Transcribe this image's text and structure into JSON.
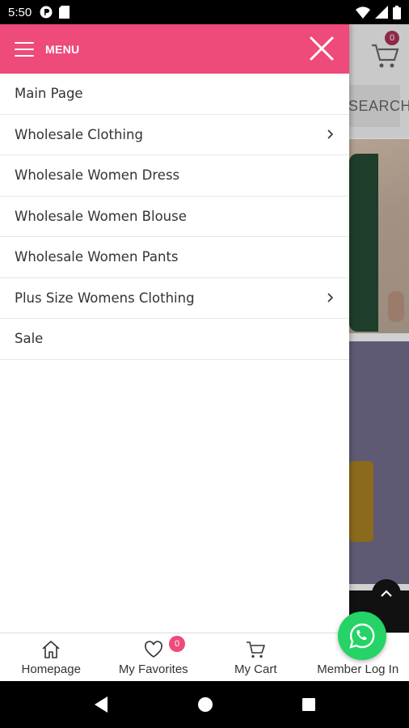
{
  "status_bar": {
    "time": "5:50"
  },
  "background": {
    "cart_count": "0",
    "search_label": "SEARCH"
  },
  "drawer": {
    "menu_title": "MENU",
    "items": [
      {
        "label": "Main Page",
        "has_submenu": false
      },
      {
        "label": "Wholesale Clothing",
        "has_submenu": true
      },
      {
        "label": "Wholesale Women Dress",
        "has_submenu": false
      },
      {
        "label": "Wholesale Women Blouse",
        "has_submenu": false
      },
      {
        "label": "Wholesale Women Pants",
        "has_submenu": false
      },
      {
        "label": "Plus Size Womens Clothing",
        "has_submenu": true
      },
      {
        "label": "Sale",
        "has_submenu": false
      }
    ]
  },
  "bottom_nav": {
    "homepage": "Homepage",
    "favorites": "My Favorites",
    "favorites_count": "0",
    "cart": "My Cart",
    "login": "Member Log In"
  },
  "colors": {
    "accent": "#ee4a7a",
    "whatsapp": "#25d366"
  }
}
